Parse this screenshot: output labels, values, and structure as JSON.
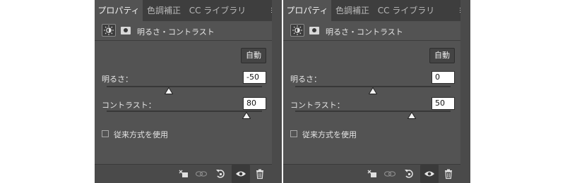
{
  "panels": [
    {
      "tabs": [
        "プロパティ",
        "色調補正",
        "CC ライブラリ"
      ],
      "header_title": "明るさ・コントラスト",
      "auto_label": "自動",
      "brightness": {
        "label": "明るさ：",
        "value": "-50",
        "level": 0.4
      },
      "contrast": {
        "label": "コントラスト：",
        "value": "80",
        "level": 0.9
      },
      "legacy_label": "従来方式を使用"
    },
    {
      "tabs": [
        "プロパティ",
        "色調補正",
        "CC ライブラリ"
      ],
      "header_title": "明るさ・コントラスト",
      "auto_label": "自動",
      "brightness": {
        "label": "明るさ：",
        "value": "0",
        "level": 0.5
      },
      "contrast": {
        "label": "コントラスト：",
        "value": "50",
        "level": 0.75
      },
      "legacy_label": "従来方式を使用"
    }
  ],
  "colors": {
    "panel_bg": "#535353",
    "tab_bar_bg": "#3e3e3e",
    "field_bg": "#ffffff"
  },
  "icons": [
    "sun-adjust-icon",
    "mask-icon",
    "panel-menu-icon",
    "clip-to-layer-icon",
    "view-previous-icon",
    "reset-icon",
    "visibility-eye-icon",
    "trash-icon",
    "slider-thumb-icon"
  ]
}
